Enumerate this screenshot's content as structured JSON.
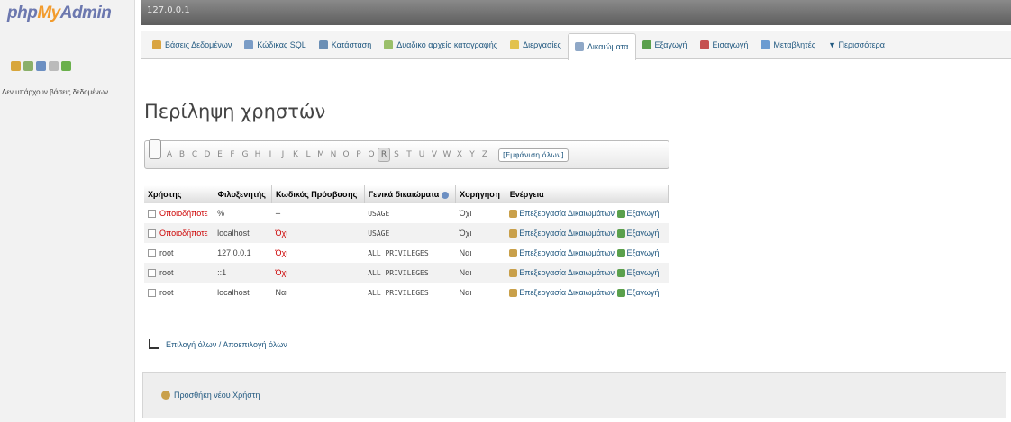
{
  "logo": {
    "php": "php",
    "my": "My",
    "admin": "Admin"
  },
  "left": {
    "no_databases": "Δεν υπάρχουν βάσεις δεδομένων"
  },
  "server": {
    "label": "127.0.0.1"
  },
  "tabs": [
    {
      "label": "Βάσεις Δεδομένων",
      "icon": "database-icon",
      "color": "#d9a441"
    },
    {
      "label": "Κώδικας SQL",
      "icon": "sql-icon",
      "color": "#7a9cc6"
    },
    {
      "label": "Κατάσταση",
      "icon": "status-icon",
      "color": "#6b8fb5"
    },
    {
      "label": "Δυαδικό αρχείο καταγραφής",
      "icon": "binlog-icon",
      "color": "#9abf6a"
    },
    {
      "label": "Διεργασίες",
      "icon": "processes-icon",
      "color": "#e2c24f"
    },
    {
      "label": "Δικαιώματα",
      "icon": "privileges-icon",
      "color": "#8fa8c7",
      "active": true
    },
    {
      "label": "Εξαγωγή",
      "icon": "export-icon",
      "color": "#5aa04c"
    },
    {
      "label": "Εισαγωγή",
      "icon": "import-icon",
      "color": "#c55050"
    },
    {
      "label": "Μεταβλητές",
      "icon": "variables-icon",
      "color": "#6b9bd1"
    },
    {
      "label": "▼ Περισσότερα",
      "icon": "",
      "color": ""
    }
  ],
  "page": {
    "title": "Περίληψη χρηστών"
  },
  "alphabet": {
    "letters": [
      "A",
      "B",
      "C",
      "D",
      "E",
      "F",
      "G",
      "H",
      "I",
      "J",
      "K",
      "L",
      "M",
      "N",
      "O",
      "P",
      "Q",
      "R",
      "S",
      "T",
      "U",
      "V",
      "W",
      "X",
      "Y",
      "Z"
    ],
    "selected": "R",
    "show_all": "[Εμφάνιση όλων]"
  },
  "table": {
    "headers": [
      "Χρήστης",
      "Φιλοξενητής",
      "Κωδικός Πρόσβασης",
      "Γενικά δικαιώματα",
      "Χορήγηση",
      "Ενέργεια"
    ],
    "rows": [
      {
        "user": "Οποιοδήποτε",
        "host": "%",
        "password": "--",
        "privileges": "USAGE",
        "grant": "Όχι",
        "edit": "Επεξεργασία Δικαιωμάτων",
        "export": "Εξαγωγή"
      },
      {
        "user": "Οποιοδήποτε",
        "host": "localhost",
        "password": "Όχι",
        "privileges": "USAGE",
        "grant": "Όχι",
        "edit": "Επεξεργασία Δικαιωμάτων",
        "export": "Εξαγωγή"
      },
      {
        "user": "root",
        "host": "127.0.0.1",
        "password": "Όχι",
        "privileges": "ALL PRIVILEGES",
        "grant": "Ναι",
        "edit": "Επεξεργασία Δικαιωμάτων",
        "export": "Εξαγωγή"
      },
      {
        "user": "root",
        "host": "::1",
        "password": "Όχι",
        "privileges": "ALL PRIVILEGES",
        "grant": "Ναι",
        "edit": "Επεξεργασία Δικαιωμάτων",
        "export": "Εξαγωγή"
      },
      {
        "user": "root",
        "host": "localhost",
        "password": "Ναι",
        "privileges": "ALL PRIVILEGES",
        "grant": "Ναι",
        "edit": "Επεξεργασία Δικαιωμάτων",
        "export": "Εξαγωγή"
      }
    ]
  },
  "select_all": "Επιλογή όλων / Αποεπιλογή όλων",
  "add_user": "Προσθήκη νέου Χρήστη"
}
